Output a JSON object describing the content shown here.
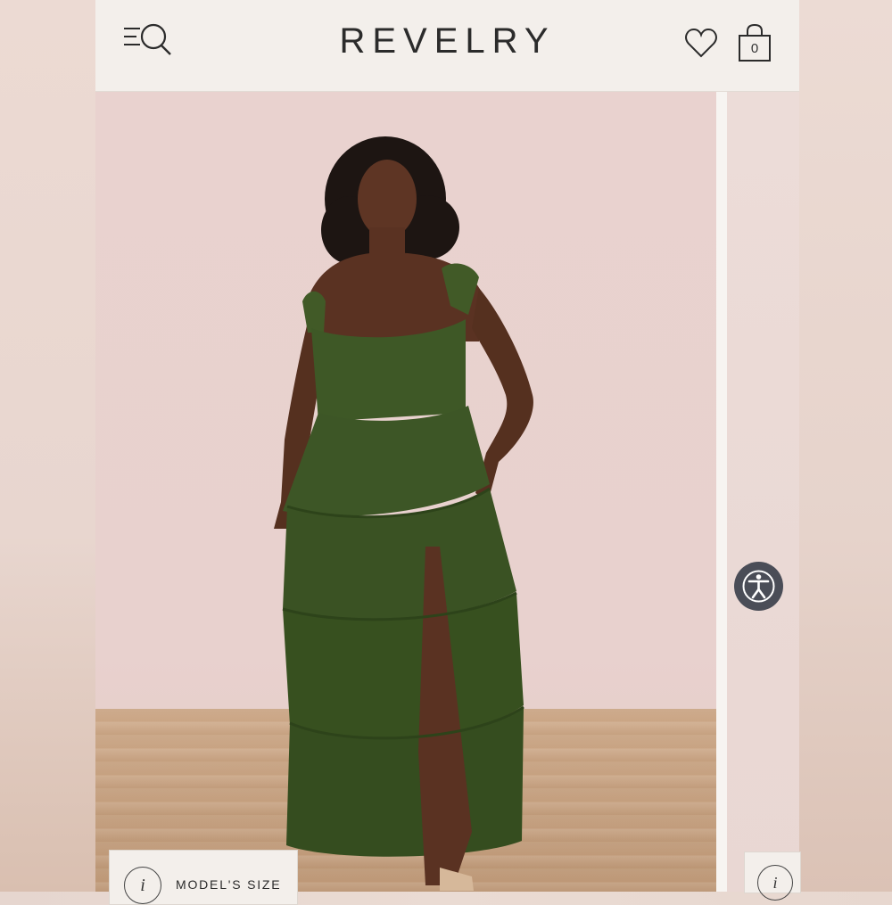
{
  "header": {
    "logo": "REVELRY",
    "menu_icon": "menu-icon",
    "search_icon": "search-icon",
    "wishlist_icon": "heart-icon",
    "bag_icon": "shopping-bag-icon",
    "bag_count": "0"
  },
  "product_image": {
    "info_icon_text": "i",
    "model_size_label": "MODEL'S SIZE"
  },
  "next_image": {
    "info_icon_text": "i"
  },
  "accessibility": {
    "icon": "accessibility-icon"
  },
  "colors": {
    "dress_green": "#3f5a28",
    "background_pink": "#e9d2cf",
    "accessibility_button": "#4a4d57",
    "header_bg": "#f3efeb"
  }
}
